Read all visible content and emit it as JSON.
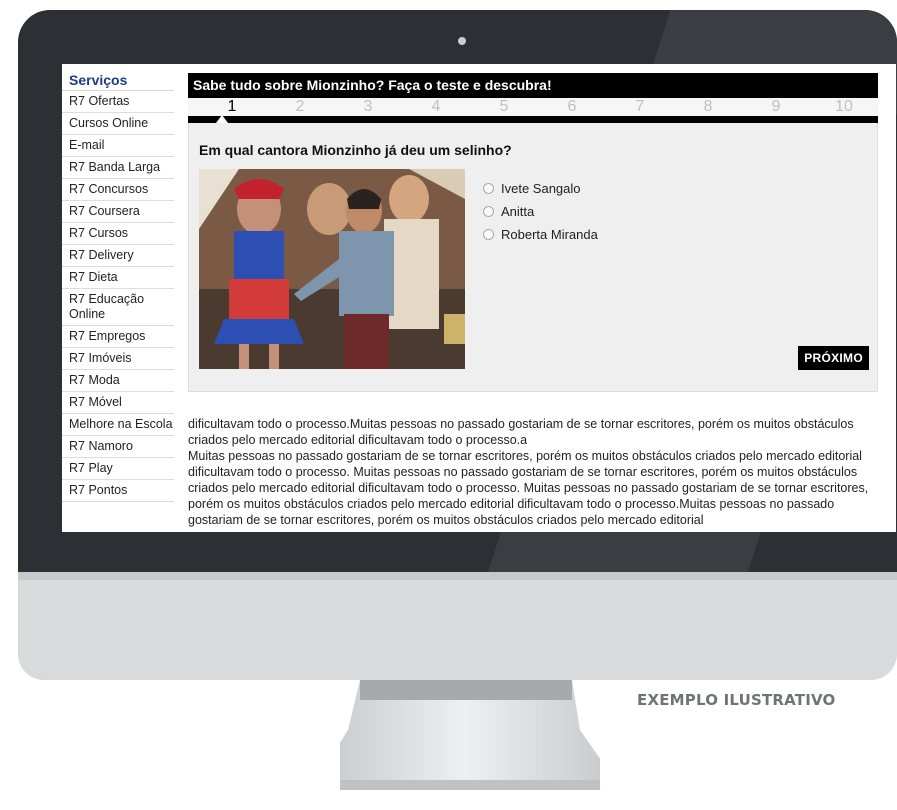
{
  "sidebar": {
    "title": "Serviços",
    "items": [
      {
        "label": "R7 Ofertas"
      },
      {
        "label": "Cursos Online"
      },
      {
        "label": "E-mail"
      },
      {
        "label": "R7 Banda Larga"
      },
      {
        "label": "R7 Concursos"
      },
      {
        "label": "R7 Coursera"
      },
      {
        "label": "R7 Cursos"
      },
      {
        "label": "R7 Delivery"
      },
      {
        "label": "R7 Dieta"
      },
      {
        "label": "R7 Educação Online"
      },
      {
        "label": "R7 Empregos"
      },
      {
        "label": "R7 Imóveis"
      },
      {
        "label": "R7 Moda"
      },
      {
        "label": "R7 Móvel"
      },
      {
        "label": "Melhore na Escola"
      },
      {
        "label": "R7 Namoro"
      },
      {
        "label": "R7 Play"
      },
      {
        "label": "R7 Pontos"
      }
    ]
  },
  "quiz": {
    "title": "Sabe tudo sobre Mionzinho? Faça o teste e descubra!",
    "steps": [
      "1",
      "2",
      "3",
      "4",
      "5",
      "6",
      "7",
      "8",
      "9",
      "10"
    ],
    "current_step": 1,
    "question": "Em qual cantora Mionzinho já deu um selinho?",
    "options": [
      {
        "label": "Ivete Sangalo"
      },
      {
        "label": "Anitta"
      },
      {
        "label": "Roberta Miranda"
      }
    ],
    "next_label": "PRÓXIMO"
  },
  "article": {
    "paragraphs": [
      "dificultavam todo o processo.Muitas pessoas no passado gostariam de se tornar escritores, porém os muitos obstáculos criados pelo mercado editorial dificultavam todo o processo.a",
      "Muitas pessoas no passado gostariam de se tornar escritores, porém os muitos obstáculos criados pelo mercado editorial dificultavam todo o processo. Muitas pessoas no passado gostariam de se tornar escritores, porém os muitos obstáculos criados pelo mercado editorial dificultavam todo o processo. Muitas pessoas no passado gostariam de se tornar escritores, porém os muitos obstáculos criados pelo mercado editorial dificultavam todo o processo.Muitas pessoas no passado gostariam de se tornar escritores, porém os muitos obstáculos criados pelo mercado editorial"
    ]
  },
  "caption": "EXEMPLO  ILUSTRATIVO",
  "colors": {
    "bezel": "#2c2f33",
    "chin": "#d9dadc",
    "sidebar_title": "#1f3a87",
    "quiz_header": "#000000"
  }
}
